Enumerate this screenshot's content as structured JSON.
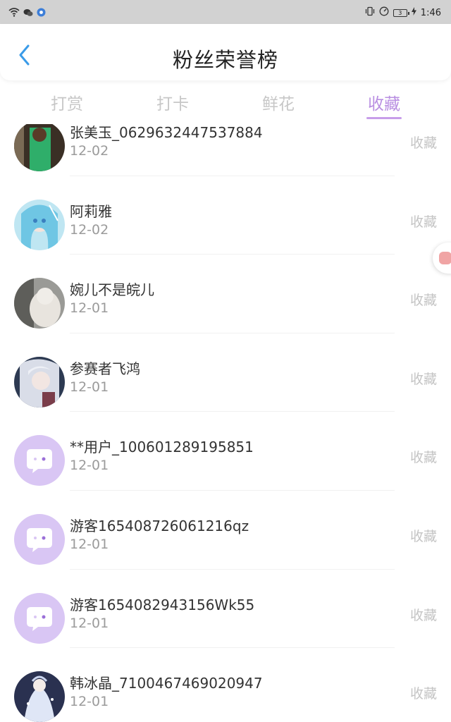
{
  "status_bar": {
    "time": "1:46",
    "battery": "3",
    "icons": [
      "wifi-icon",
      "wechat-icon",
      "browser-icon",
      "vibrate-icon",
      "data-saver-icon",
      "battery-icon",
      "charging-icon"
    ]
  },
  "header": {
    "title": "粉丝荣誉榜",
    "back_icon": "chevron-left-icon",
    "accent": "#3a9be8"
  },
  "tabs": {
    "items": [
      "打赏",
      "打卡",
      "鲜花",
      "收藏"
    ],
    "active_index": 3,
    "active_color": "#b98fe2",
    "inactive_color": "#c7c7c7"
  },
  "list": {
    "items": [
      {
        "name": "张美玉_0629632447537884",
        "date": "12-02",
        "action": "收藏",
        "avatar": "photo-avatar-green"
      },
      {
        "name": "阿莉雅",
        "date": "12-02",
        "action": "收藏",
        "avatar": "photo-avatar-anime-blue"
      },
      {
        "name": "婉儿不是皖儿",
        "date": "12-01",
        "action": "收藏",
        "avatar": "photo-avatar-grey"
      },
      {
        "name": "参赛者飞鸿",
        "date": "12-01",
        "action": "收藏",
        "avatar": "photo-avatar-anime-dark"
      },
      {
        "name": "**用户_100601289195851",
        "date": "12-01",
        "action": "收藏",
        "avatar": "default-chat-avatar"
      },
      {
        "name": "游客165408726061216qz",
        "date": "12-01",
        "action": "收藏",
        "avatar": "default-chat-avatar"
      },
      {
        "name": "游客1654082943156Wk55",
        "date": "12-01",
        "action": "收藏",
        "avatar": "default-chat-avatar"
      },
      {
        "name": "韩冰晶_7100467469020947",
        "date": "12-01",
        "action": "收藏",
        "avatar": "photo-avatar-anime-white"
      }
    ]
  },
  "colors": {
    "default_avatar_bg": "#d9c6f4",
    "name_text": "#333333",
    "date_text": "#9b9b9b",
    "action_text": "#c4c4c4"
  }
}
